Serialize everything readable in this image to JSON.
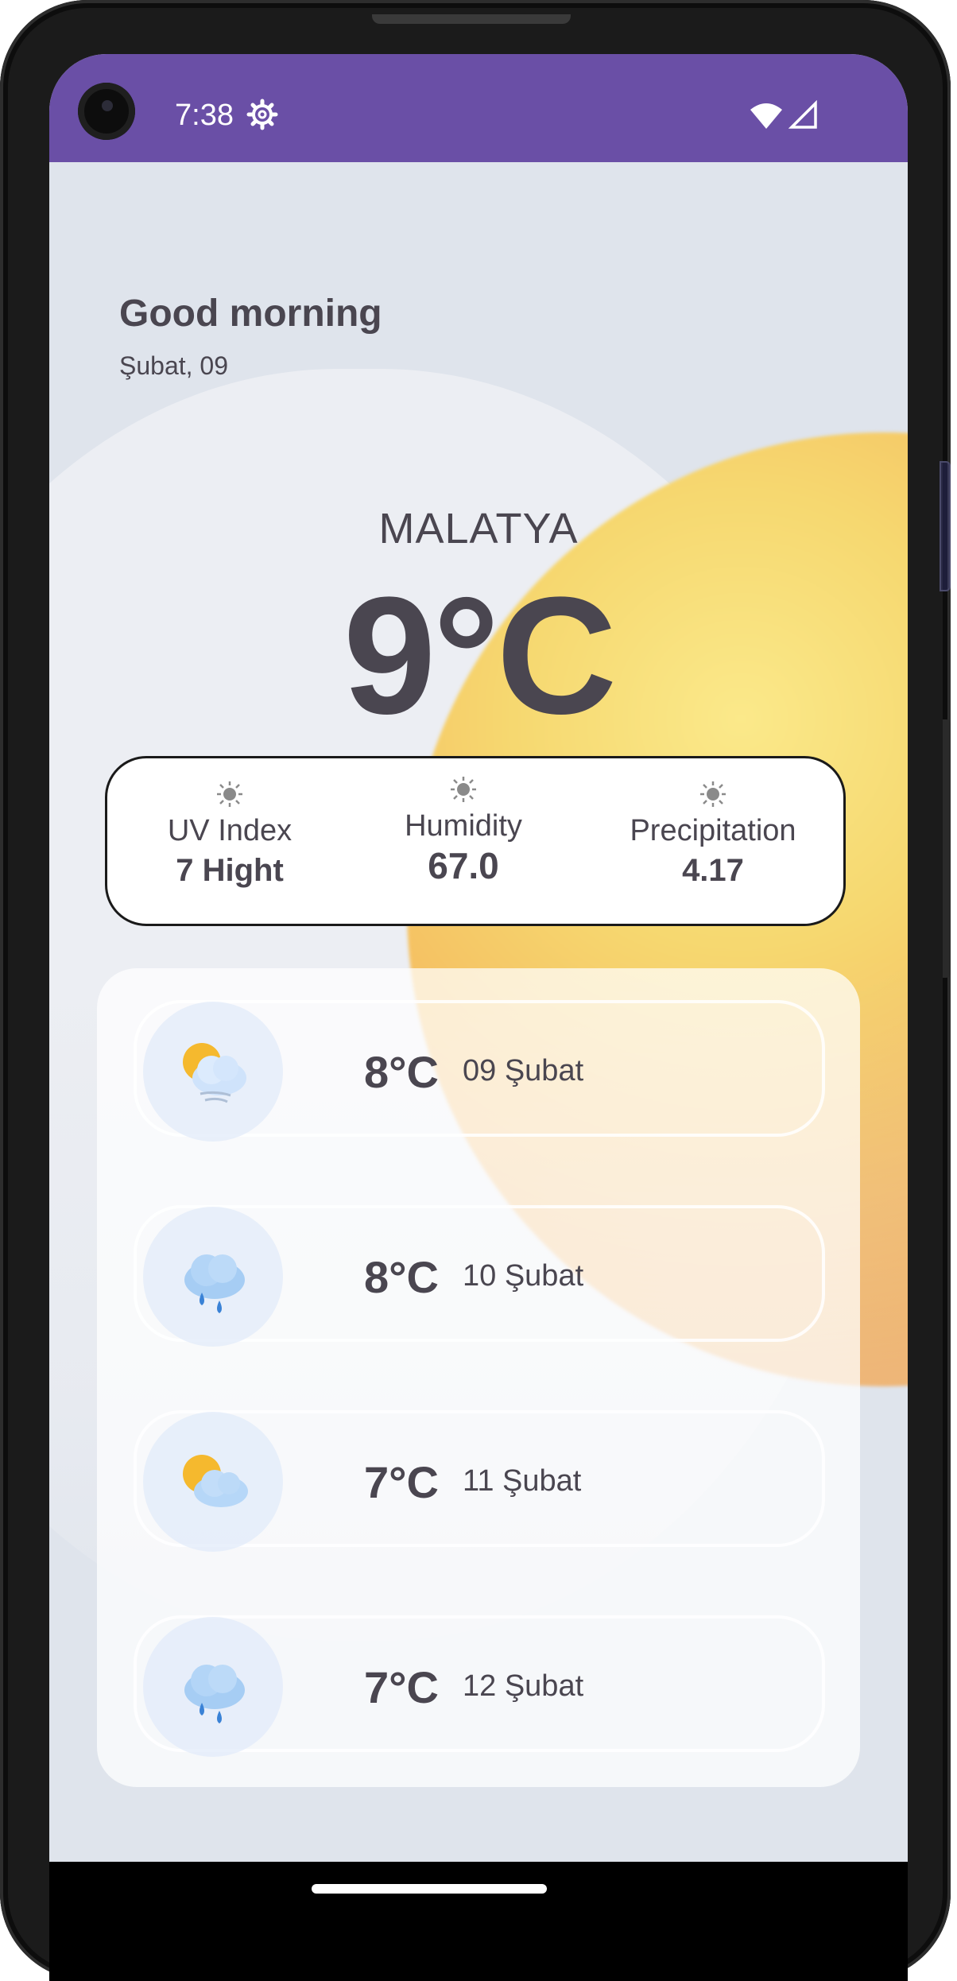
{
  "status_bar": {
    "time": "7:38",
    "icons": [
      "settings-icon",
      "wifi-icon",
      "signal-icon"
    ]
  },
  "header": {
    "greeting": "Good morning",
    "date": "Şubat, 09"
  },
  "current": {
    "city": "MALATYA",
    "temperature": "9°C"
  },
  "stats": [
    {
      "label": "UV Index",
      "value": "7 Hight",
      "icon": "sun-icon"
    },
    {
      "label": "Humidity",
      "value": "67.0",
      "icon": "sun-icon"
    },
    {
      "label": "Precipitation",
      "value": "4.17",
      "icon": "sun-icon"
    }
  ],
  "forecast": [
    {
      "temp": "8°C",
      "date": "09 Şubat",
      "icon": "partly-cloudy-windy-icon"
    },
    {
      "temp": "8°C",
      "date": "10 Şubat",
      "icon": "rain-cloud-icon"
    },
    {
      "temp": "7°C",
      "date": "11 Şubat",
      "icon": "partly-cloudy-icon"
    },
    {
      "temp": "7°C",
      "date": "12 Şubat",
      "icon": "rain-cloud-icon"
    }
  ],
  "colors": {
    "status_bar": "#6a4fa6",
    "text": "#4a4650",
    "background": "#dfe4ec",
    "sun": "#f5b65c"
  }
}
